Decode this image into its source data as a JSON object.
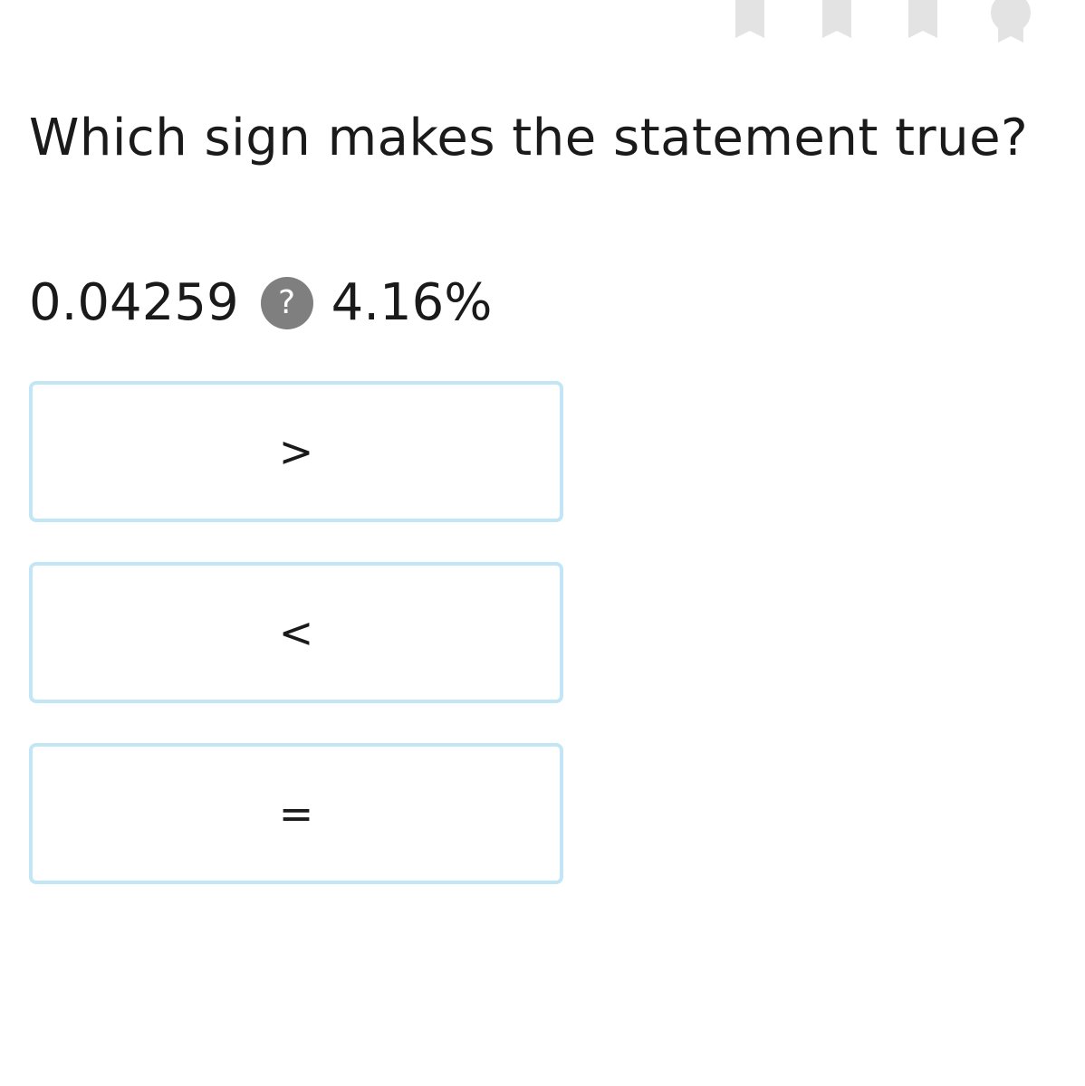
{
  "header": {
    "progress_icons": [
      "ribbon-icon",
      "ribbon-icon",
      "ribbon-icon",
      "award-medal-icon"
    ],
    "icon_color": "#e3e3e3"
  },
  "question": {
    "prompt": "Which sign makes the statement true?"
  },
  "statement": {
    "left_value": "0.04259",
    "blank_symbol": "?",
    "right_value": "4.16%"
  },
  "choices": [
    {
      "label": ">"
    },
    {
      "label": "<"
    },
    {
      "label": "="
    }
  ],
  "colors": {
    "choice_border": "#c2e6f6",
    "blank_badge": "#7f7f7f",
    "text": "#1a1a1a"
  }
}
